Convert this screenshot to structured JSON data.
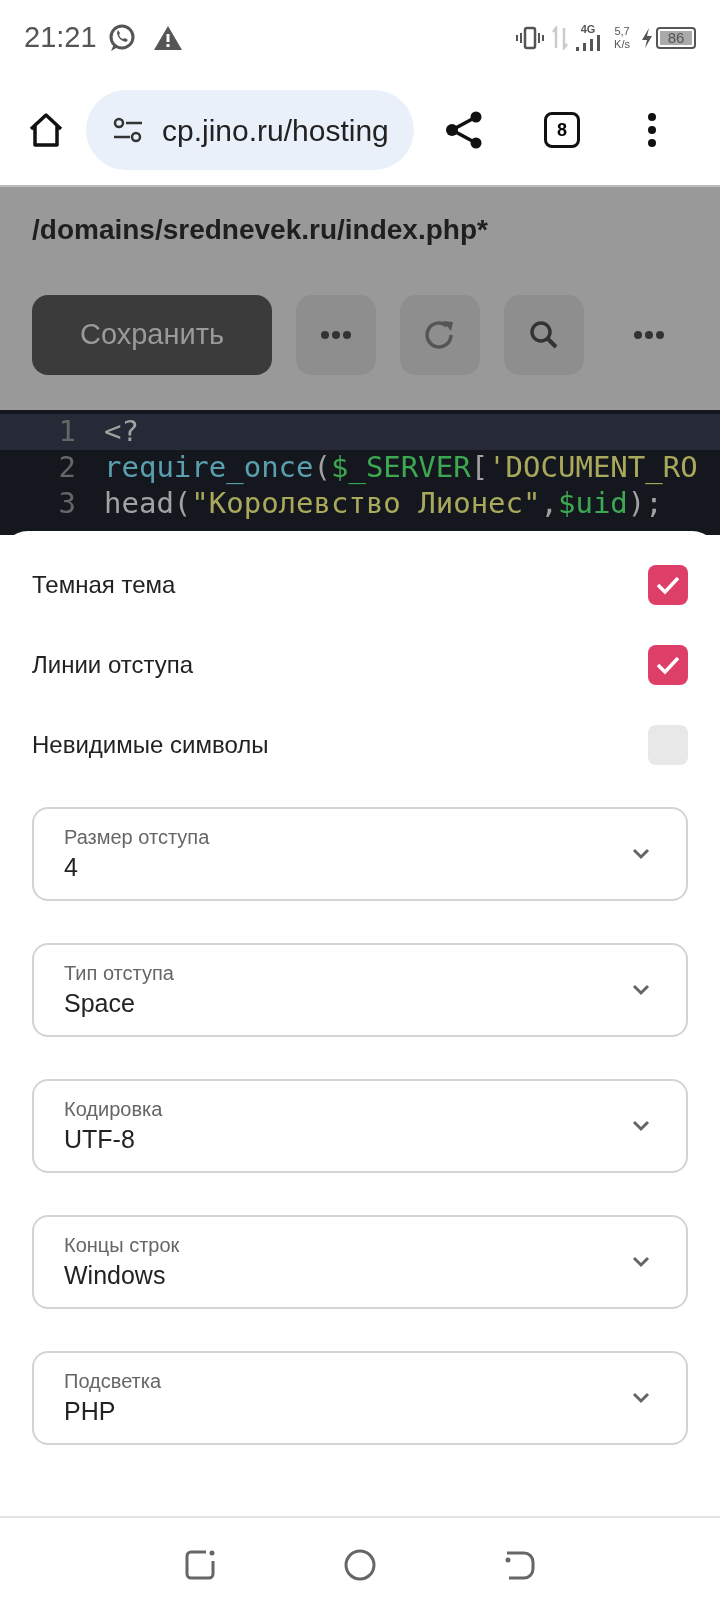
{
  "status_bar": {
    "time": "21:21",
    "network": "4G",
    "speed_value": "5,7",
    "speed_unit": "K/s",
    "battery": "86"
  },
  "browser": {
    "url": "cp.jino.ru/hosting",
    "tab_count": "8"
  },
  "editor": {
    "file_path": "/domains/srednevek.ru/index.php*",
    "toolbar": [
      {
        "kind": "text",
        "label": "Сохранить"
      },
      {
        "kind": "more"
      },
      {
        "kind": "reload"
      },
      {
        "kind": "search"
      },
      {
        "kind": "more_plain"
      }
    ],
    "lines": [
      {
        "number": "1",
        "current": true,
        "tokens": [
          {
            "kind": "plain",
            "text": "<?"
          }
        ]
      },
      {
        "number": "2",
        "current": false,
        "tokens": [
          {
            "kind": "func",
            "text": "require_once"
          },
          {
            "kind": "plain",
            "text": "("
          },
          {
            "kind": "var",
            "text": "$_SERVER"
          },
          {
            "kind": "plain",
            "text": "["
          },
          {
            "kind": "string",
            "text": "'DOCUMENT_RO"
          }
        ]
      },
      {
        "number": "3",
        "current": false,
        "tokens": [
          {
            "kind": "plain",
            "text": "head("
          },
          {
            "kind": "string",
            "text": "\"Королевство Лионес\""
          },
          {
            "kind": "plain",
            "text": ","
          },
          {
            "kind": "var",
            "text": "$uid"
          },
          {
            "kind": "plain",
            "text": ");"
          }
        ]
      }
    ]
  },
  "settings": {
    "toggles": [
      {
        "label": "Темная тема",
        "checked": true
      },
      {
        "label": "Линии отступа",
        "checked": true
      },
      {
        "label": "Невидимые символы",
        "checked": false
      }
    ],
    "selects": [
      {
        "label": "Размер отступа",
        "value": "4"
      },
      {
        "label": "Тип отступа",
        "value": "Space"
      },
      {
        "label": "Кодировка",
        "value": "UTF-8"
      },
      {
        "label": "Концы строк",
        "value": "Windows"
      },
      {
        "label": "Подсветка",
        "value": "PHP"
      }
    ]
  }
}
